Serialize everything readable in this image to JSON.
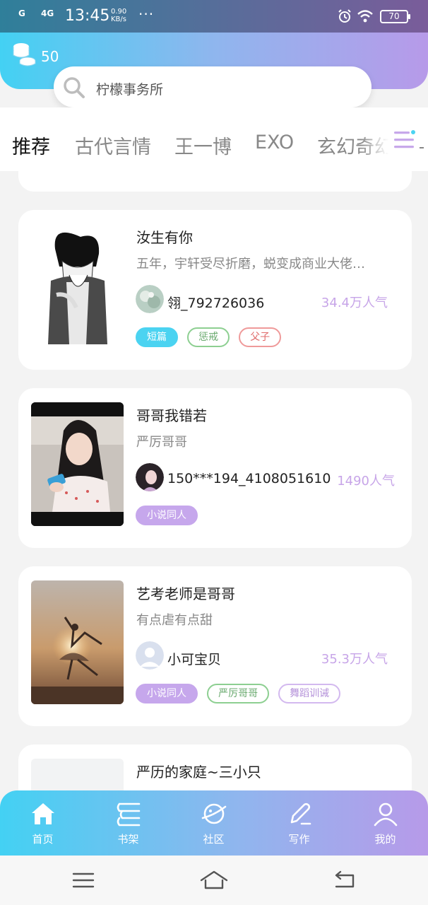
{
  "status_bar": {
    "network1": "G",
    "network2": "4G",
    "time": "13:45",
    "speed_value": "0.90",
    "speed_unit": "KB/s",
    "more": "···",
    "battery": "70"
  },
  "header": {
    "coin_count": "50",
    "search_placeholder": "柠檬事务所"
  },
  "tabs": [
    "推荐",
    "古代言情",
    "王一博",
    "EXO",
    "玄幻奇幻"
  ],
  "active_tab": "推荐",
  "stories": [
    {
      "title": "汝生有你",
      "desc": "五年，宇轩受尽折磨，蜕变成商业大佬…",
      "author": "翎_792726036",
      "popularity": "34.4万人气",
      "tags": [
        "短篇",
        "惩戒",
        "父子"
      ]
    },
    {
      "title": "哥哥我错若",
      "desc": "严厉哥哥",
      "author": "150***194_4108051610",
      "popularity": "1490人气",
      "tags": [
        "小说同人"
      ]
    },
    {
      "title": "艺考老师是哥哥",
      "desc": "有点虐有点甜",
      "author": "小可宝贝",
      "popularity": "35.3万人气",
      "tags": [
        "小说同人",
        "严厉哥哥",
        "舞蹈训诫"
      ]
    },
    {
      "title": "严历的家庭~三小只"
    }
  ],
  "bottom_nav": [
    "首页",
    "书架",
    "社区",
    "写作",
    "我的"
  ],
  "colors": {
    "accent_cyan": "#43d1f3",
    "accent_purple": "#b79ae9",
    "popularity": "#c7a5e8"
  }
}
